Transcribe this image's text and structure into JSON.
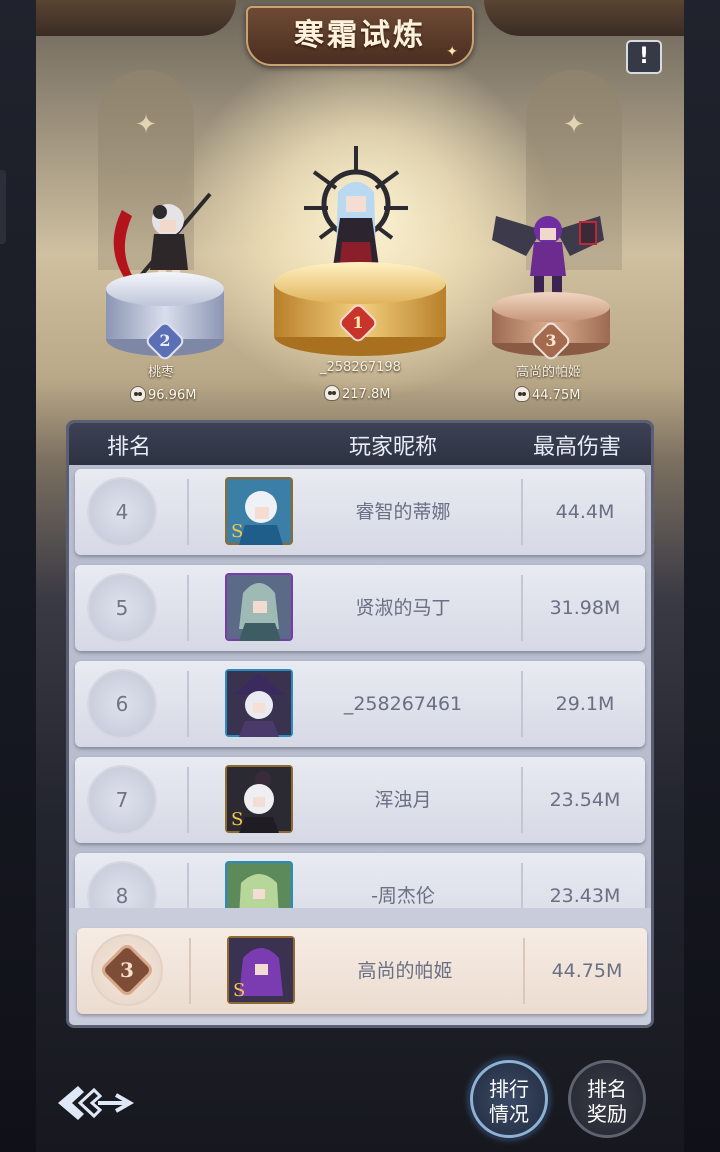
{
  "header": {
    "title": "寒霜试炼",
    "info_icon": "exclamation-icon"
  },
  "podium": [
    {
      "rank": "2",
      "name": "桃枣",
      "score": "96.96M",
      "color": "#5b6fb6"
    },
    {
      "rank": "1",
      "name": "_258267198",
      "score": "217.8M",
      "color": "#c8342a"
    },
    {
      "rank": "3",
      "name": "高尚的帕姬",
      "score": "44.75M",
      "color": "#a46a4e"
    }
  ],
  "table": {
    "headers": {
      "rank": "排名",
      "name": "玩家昵称",
      "damage": "最高伤害"
    },
    "rows": [
      {
        "rank": "4",
        "name": "睿智的蒂娜",
        "damage": "44.4M"
      },
      {
        "rank": "5",
        "name": "贤淑的马丁",
        "damage": "31.98M"
      },
      {
        "rank": "6",
        "name": "_258267461",
        "damage": "29.1M"
      },
      {
        "rank": "7",
        "name": "浑浊月",
        "damage": "23.54M"
      },
      {
        "rank": "8",
        "name": "-周杰伦",
        "damage": "23.43M"
      }
    ],
    "self": {
      "rank": "3",
      "name": "高尚的帕姬",
      "damage": "44.75M"
    }
  },
  "buttons": {
    "back_icon": "back-arrow-icon",
    "rank_status": [
      "排行",
      "情况"
    ],
    "rank_reward": [
      "排名",
      "奖励"
    ]
  }
}
